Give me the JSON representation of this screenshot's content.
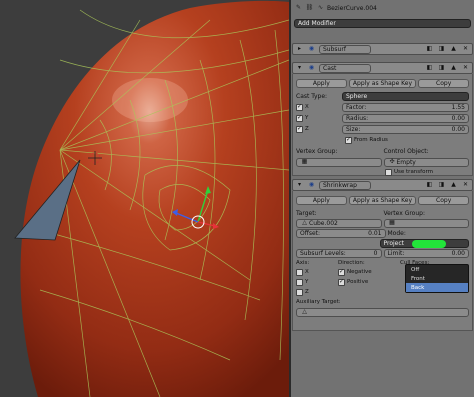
{
  "props": {
    "object_name": "BezierCurve.004",
    "add_modifier": "Add Modifier",
    "subsurf": {
      "name": "Subsurf"
    },
    "cast": {
      "name": "Cast",
      "apply": "Apply",
      "apply_shape": "Apply as Shape Key",
      "copy": "Copy",
      "cast_type_label": "Cast Type:",
      "cast_type": "Sphere",
      "axis_x": "X",
      "axis_y": "Y",
      "axis_z": "Z",
      "factor_label": "Factor:",
      "factor": "1.55",
      "radius_label": "Radius:",
      "radius": "0.00",
      "size_label": "Size:",
      "size": "0.00",
      "from_radius": "From Radius",
      "vgroup_label": "Vertex Group:",
      "control_label": "Control Object:",
      "control_value": "Empty",
      "use_transform": "Use transform"
    },
    "shrinkwrap": {
      "name": "Shrinkwrap",
      "apply": "Apply",
      "apply_shape": "Apply as Shape Key",
      "copy": "Copy",
      "target_label": "Target:",
      "target": "Cube.002",
      "vgroup_label": "Vertex Group:",
      "offset_label": "Offset:",
      "offset": "0.01",
      "mode_label": "Mode:",
      "mode": "Project",
      "subsurf_label": "Subsurf Levels:",
      "subsurf": "0",
      "limit_label": "Limit:",
      "limit": "0.00",
      "axis_label": "Axis:",
      "axis_x": "X",
      "axis_y": "Y",
      "axis_z": "Z",
      "direction_label": "Direction:",
      "negative": "Negative",
      "positive": "Positive",
      "cull_label": "Cull Faces:",
      "cull_options": [
        "Off",
        "Front",
        "Back"
      ],
      "aux_label": "Auxiliary Target:"
    }
  },
  "colors": {
    "accent": "#5680c2",
    "highlight_green": "#22e43a",
    "skin": "#b43a22"
  }
}
